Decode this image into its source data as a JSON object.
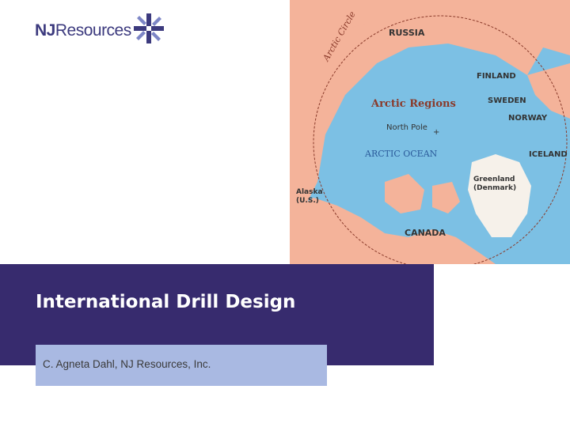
{
  "logo": {
    "prefix": "NJ",
    "name": "Resources"
  },
  "map": {
    "title": "Arctic Regions",
    "arctic_circle_label": "Arctic Circle",
    "pole_label": "North Pole",
    "ocean_label": "ARCTIC OCEAN",
    "labels": {
      "russia": "RUSSIA",
      "finland": "FINLAND",
      "sweden": "SWEDEN",
      "norway": "NORWAY",
      "iceland": "ICELAND",
      "greenland_1": "Greenland",
      "greenland_2": "(Denmark)",
      "alaska_1": "Alaska",
      "alaska_2": "(U.S.)",
      "canada": "CANADA"
    }
  },
  "slide": {
    "title": "International Drill Design",
    "subtitle": "C. Agneta Dahl, NJ Resources, Inc."
  }
}
